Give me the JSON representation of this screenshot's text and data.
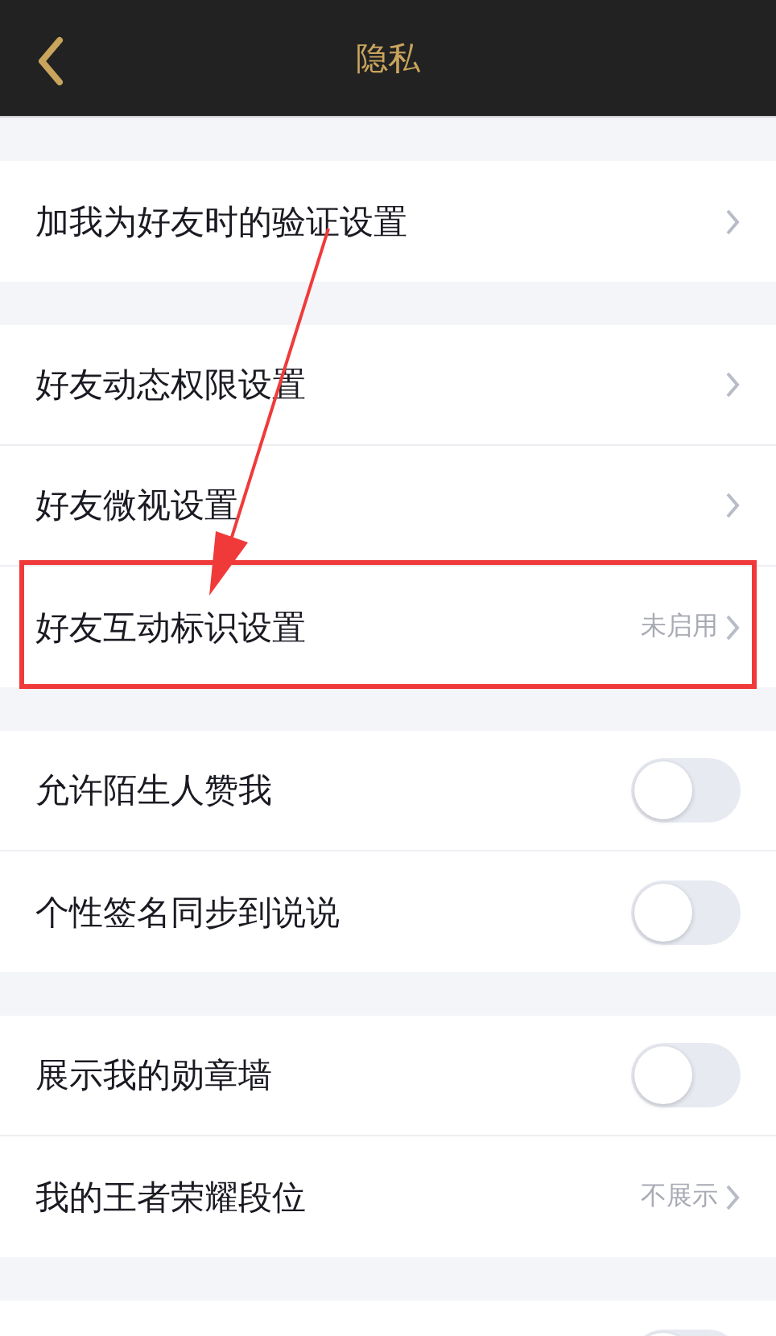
{
  "header": {
    "title": "隐私"
  },
  "sections": [
    {
      "items": [
        {
          "kind": "link",
          "label": "加我为好友时的验证设置",
          "highlighted": false
        }
      ]
    },
    {
      "items": [
        {
          "kind": "link",
          "label": "好友动态权限设置",
          "highlighted": false
        },
        {
          "kind": "link",
          "label": "好友微视设置",
          "highlighted": false
        },
        {
          "kind": "link",
          "label": "好友互动标识设置",
          "value": "未启用",
          "highlighted": true
        }
      ]
    },
    {
      "items": [
        {
          "kind": "toggle",
          "label": "允许陌生人赞我",
          "on": false
        },
        {
          "kind": "toggle",
          "label": "个性签名同步到说说",
          "on": false
        }
      ]
    },
    {
      "items": [
        {
          "kind": "toggle",
          "label": "展示我的勋章墙",
          "on": false
        },
        {
          "kind": "link",
          "label": "我的王者荣耀段位",
          "value": "不展示",
          "highlighted": false
        }
      ]
    },
    {
      "items": [
        {
          "kind": "toggle",
          "on": false
        }
      ]
    }
  ]
}
